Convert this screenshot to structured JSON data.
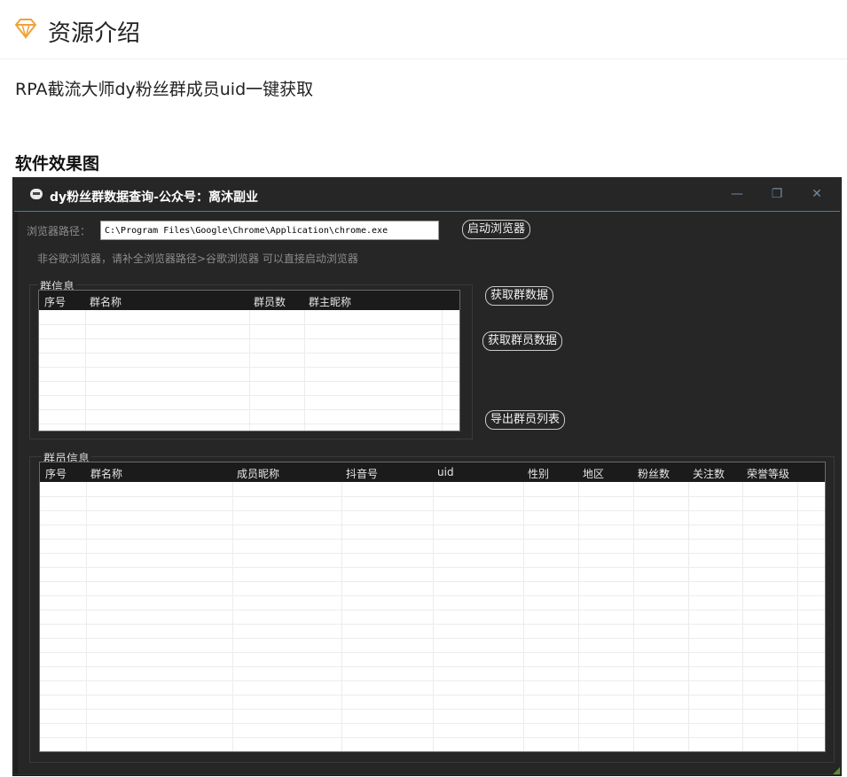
{
  "header": {
    "title": "资源介绍",
    "icon": "diamond-icon"
  },
  "intro_text": "RPA截流大师dy粉丝群成员uid一键获取",
  "section_heading": "软件效果图",
  "window": {
    "title": "dy粉丝群数据查询-公众号：离沐副业",
    "controls": {
      "minimize": "—",
      "restore": "❐",
      "close": "✕"
    },
    "browser_label": "浏览器路径：",
    "browser_path": "C:\\Program Files\\Google\\Chrome\\Application\\chrome.exe",
    "launch_button": "启动浏览器",
    "hint": "非谷歌浏览器，请补全浏览器路径>谷歌浏览器 可以直接启动浏览器",
    "group_info": {
      "title": "群信息",
      "columns": [
        "序号",
        "群名称",
        "群员数",
        "群主昵称"
      ]
    },
    "buttons": {
      "get_group": "获取群数据",
      "get_members": "获取群员数据",
      "export": "导出群员列表"
    },
    "member_info": {
      "title": "群员信息",
      "columns": [
        "序号",
        "群名称",
        "成员昵称",
        "抖音号",
        "uid",
        "性别",
        "地区",
        "粉丝数",
        "关注数",
        "荣誉等级"
      ]
    }
  }
}
